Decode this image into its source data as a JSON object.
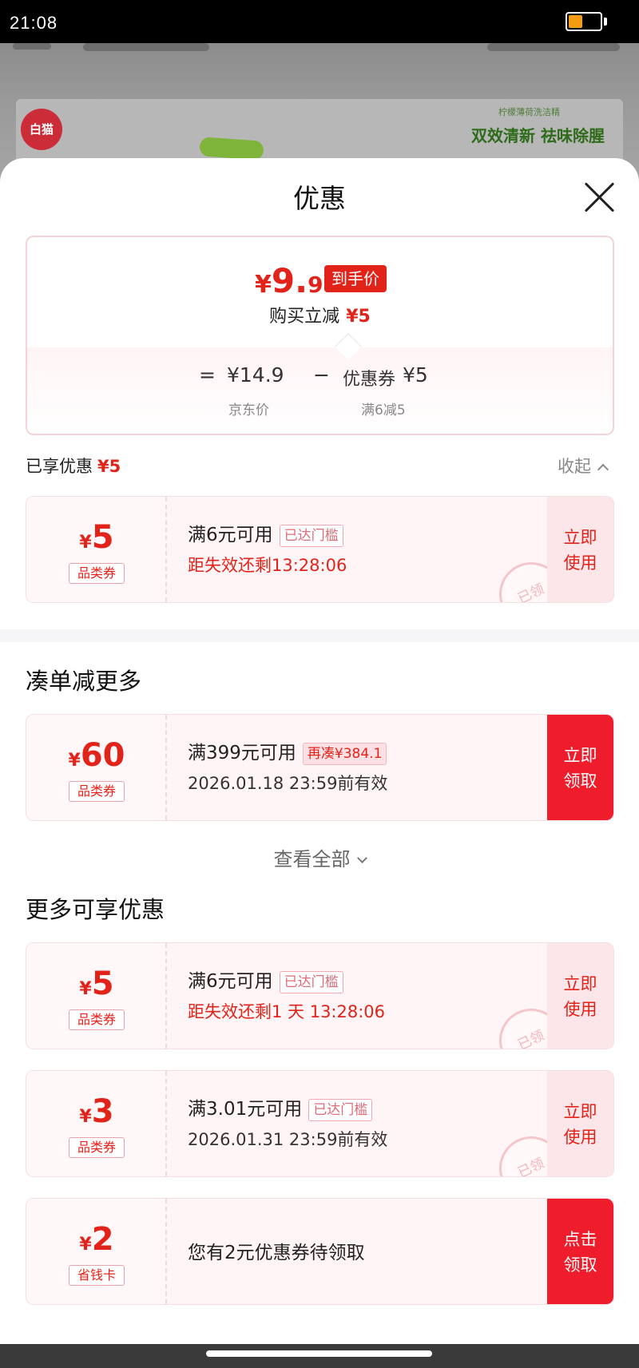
{
  "status_bar": {
    "time": "21:08",
    "battery_level": 0.45,
    "battery_color": "#f39c12"
  },
  "background_page": {
    "slogan": "双效清新 祛味除腥",
    "slogan_small": "柠檬薄荷洗洁精",
    "logo_text": "白猫"
  },
  "sheet": {
    "title": "优惠",
    "close_icon": "close-icon"
  },
  "summary": {
    "final_price": {
      "yen": "¥",
      "integer": "9.",
      "decimal": "9"
    },
    "final_tag": "到手价",
    "reduce_label": "购买立减",
    "reduce_value": "¥5",
    "equals": "=",
    "jd_price": "¥14.9",
    "minus": "−",
    "coupon_label": "优惠券",
    "coupon_value": "¥5",
    "jd_price_label": "京东价",
    "coupon_rule": "满6减5"
  },
  "enjoyed": {
    "label": "已享优惠",
    "value": "¥5",
    "collapse_label": "收起"
  },
  "enjoyed_coupon": {
    "yen": "¥",
    "amount": "5",
    "kind": "品类券",
    "condition": "满6元可用",
    "badge": "已达门槛",
    "expiry": "距失效还剩13:28:06",
    "action_line1": "立即",
    "action_line2": "使用",
    "stamp": "已领"
  },
  "combine": {
    "title": "凑单减更多",
    "coupon": {
      "yen": "¥",
      "amount": "60",
      "kind": "品类券",
      "condition": "满399元可用",
      "badge": "再凑¥384.1",
      "validity": "2026.01.18 23:59前有效",
      "action_line1": "立即",
      "action_line2": "领取"
    },
    "view_all": "查看全部"
  },
  "more": {
    "title": "更多可享优惠",
    "coupons": [
      {
        "yen": "¥",
        "amount": "5",
        "kind": "品类券",
        "condition": "满6元可用",
        "badge": "已达门槛",
        "sub": "距失效还剩1 天 13:28:06",
        "action_line1": "立即",
        "action_line2": "使用",
        "stamp": "已领"
      },
      {
        "yen": "¥",
        "amount": "3",
        "kind": "品类券",
        "condition": "满3.01元可用",
        "badge": "已达门槛",
        "sub": "2026.01.31 23:59前有效",
        "action_line1": "立即",
        "action_line2": "使用",
        "stamp": "已领"
      },
      {
        "yen": "¥",
        "amount": "2",
        "kind": "省钱卡",
        "message": "您有2元优惠券待领取",
        "action_line1": "点击",
        "action_line2": "领取"
      }
    ]
  },
  "colors": {
    "accent_red": "#e2231a",
    "button_red": "#ef1d2c",
    "coupon_bg": "#fff5f6"
  }
}
